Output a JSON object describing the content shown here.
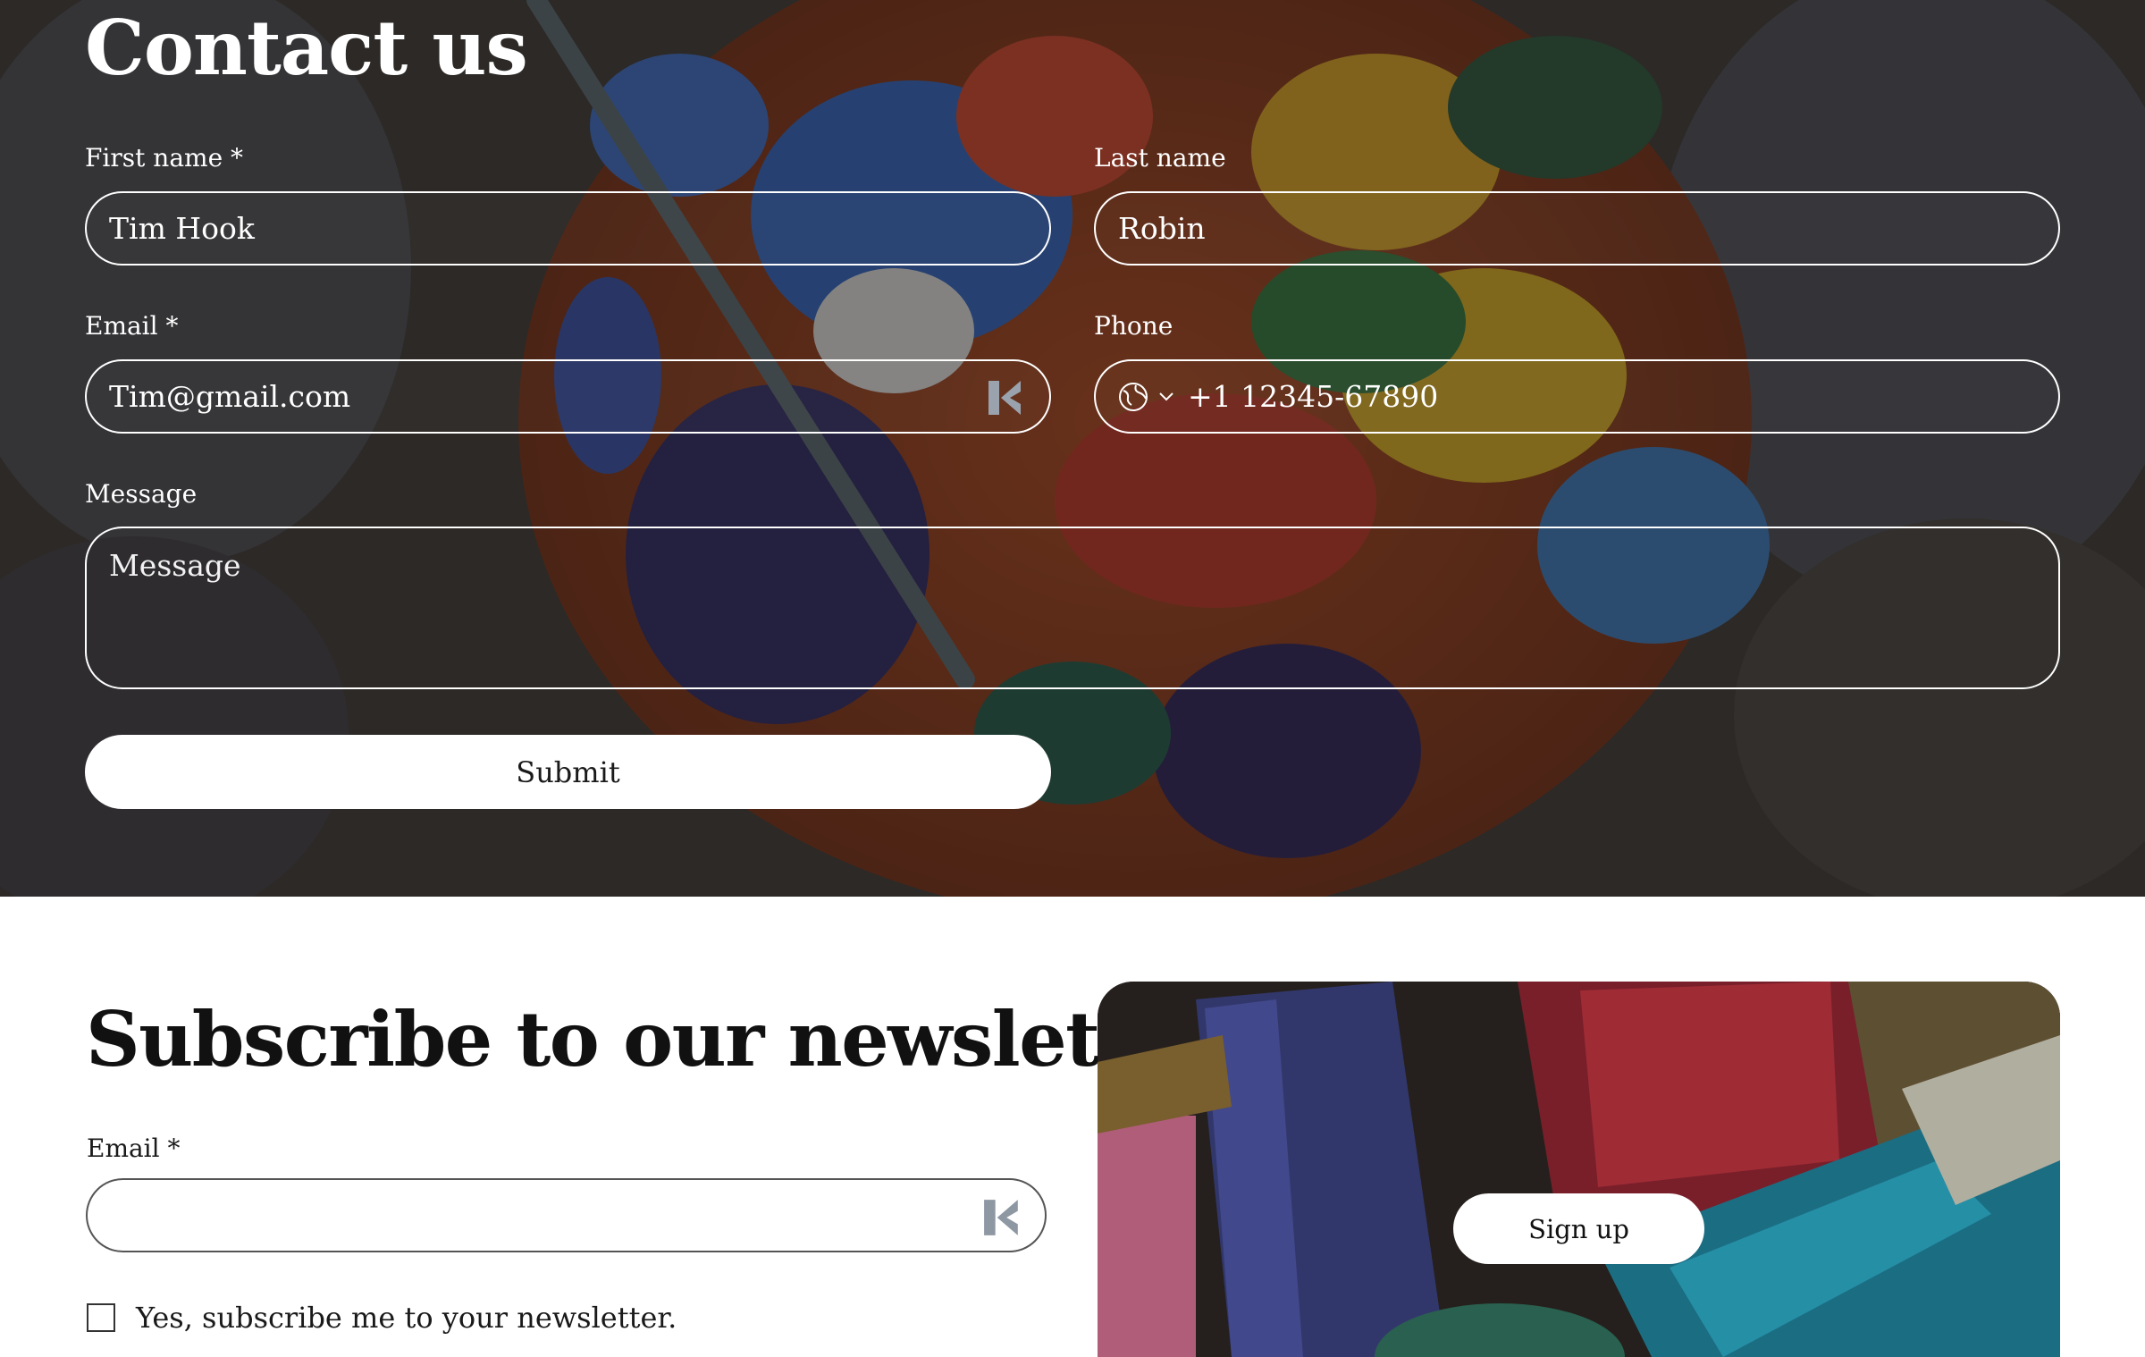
{
  "contact": {
    "title": "Contact us",
    "first_name": {
      "label": "First name *",
      "value": "Tim Hook"
    },
    "last_name": {
      "label": "Last name",
      "value": "Robin"
    },
    "email": {
      "label": "Email *",
      "value": "Tim@gmail.com"
    },
    "phone": {
      "label": "Phone",
      "value": "+1 12345-67890"
    },
    "message": {
      "label": "Message",
      "placeholder": "Message"
    },
    "submit_label": "Submit"
  },
  "newsletter": {
    "title": "Subscribe to our newsletter",
    "email_label": "Email *",
    "email_value": "",
    "checkbox_label": "Yes, subscribe me to your newsletter.",
    "checkbox_checked": false,
    "signup_label": "Sign up"
  },
  "icons": {
    "autofill": "autofill-k-icon",
    "globe": "globe-icon",
    "chevron": "chevron-down-icon",
    "checkbox": "checkbox-icon"
  },
  "colors": {
    "overlay": "#1e1b1a",
    "field_border": "#ffffff",
    "autofill_icon": "#9aa3ad",
    "text_dark": "#111111"
  }
}
